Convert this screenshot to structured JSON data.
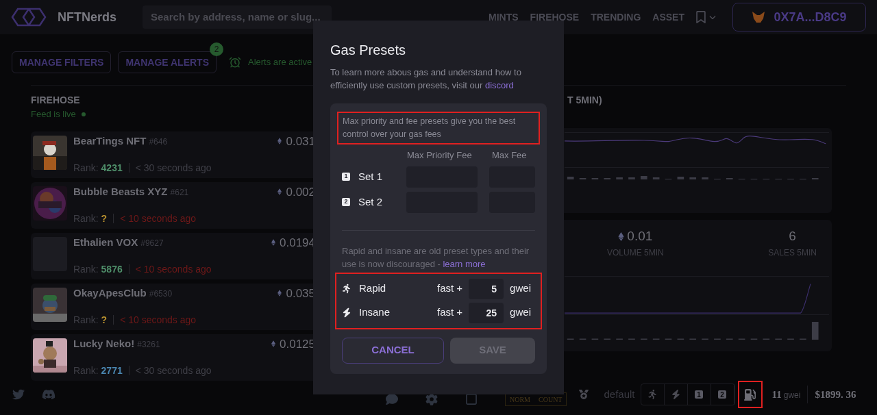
{
  "header": {
    "logo": "NFTNerds",
    "search": {
      "placeholder": "Search by address, name or slug..."
    },
    "nav": [
      "MINTS",
      "FIREHOSE",
      "TRENDING",
      "ASSET"
    ],
    "wallet": "0X7A...D8C9"
  },
  "toolbar": {
    "buttons": [
      "MANAGE FILTERS",
      "MANAGE ALERTS"
    ],
    "alerts_badge": "2",
    "alerts_status": "Alerts are active"
  },
  "feed": {
    "title": "FIREHOSE",
    "status": "Feed is live",
    "items": [
      {
        "name": "BearTings NFT",
        "token": "#646",
        "price": "0.031",
        "rank_label": "Rank:",
        "rank": "4231",
        "color": "#4f8f6a",
        "time": "< 30 seconds ago",
        "recent": false,
        "has_image": true
      },
      {
        "name": "Bubble Beasts XYZ",
        "token": "#621",
        "price": "0.002",
        "rank_label": "Rank:",
        "rank": "?",
        "color": "#b8912f",
        "time": "< 10 seconds ago",
        "recent": true,
        "has_image": true
      },
      {
        "name": "Ethalien VOX",
        "token": "#9627",
        "price": "0.0194",
        "rank_label": "Rank:",
        "rank": "5876",
        "color": "#4f8f6a",
        "time": "< 10 seconds ago",
        "recent": true,
        "has_image": false
      },
      {
        "name": "OkayApesClub",
        "token": "#6530",
        "price": "0.035",
        "rank_label": "Rank:",
        "rank": "?",
        "color": "#b8912f",
        "time": "< 10 seconds ago",
        "recent": true,
        "has_image": true
      },
      {
        "name": "Lucky Neko!",
        "token": "#3261",
        "price": "0.0125",
        "rank_label": "Rank:",
        "rank": "2771",
        "color": "#4a86b0",
        "time": "< 30 seconds ago",
        "recent": false,
        "has_image": true
      }
    ]
  },
  "stats_panel": {
    "heading": "T 5MIN)",
    "stats": [
      {
        "value": "0.01",
        "label": "VOLUME 5MIN",
        "eth": true
      },
      {
        "value": "6",
        "label": "SALES 5MIN",
        "eth": false
      }
    ]
  },
  "modal": {
    "title": "Gas Presets",
    "intro": "To learn more abous gas and understand how to efficiently use custom presets, visit our",
    "intro_link": "discord",
    "note": "Max priority and fee presets give you the best control over your gas fees",
    "columns": [
      "Max Priority Fee",
      "Max Fee"
    ],
    "sets": [
      {
        "badge": "1",
        "label": "Set 1"
      },
      {
        "badge": "2",
        "label": "Set 2"
      }
    ],
    "legacy_note": "Rapid and insane are old preset types and their use is now discouraged -",
    "legacy_link": "learn more",
    "presets": [
      {
        "kind": "rapid",
        "label": "Rapid",
        "prefix": "fast +",
        "value": "5",
        "unit": "gwei"
      },
      {
        "kind": "insane",
        "label": "Insane",
        "prefix": "fast +",
        "value": "25",
        "unit": "gwei"
      }
    ],
    "cancel": "CANCEL",
    "save": {
      "label": "SAVE",
      "disabled": true
    }
  },
  "footer": {
    "mode_tabs": [
      "NORM",
      "COUNT"
    ],
    "preset_label": "default",
    "preset_buttons": [
      {
        "kind": "rapid"
      },
      {
        "kind": "insane"
      },
      {
        "kind": "set",
        "badge": "1"
      },
      {
        "kind": "set",
        "badge": "2"
      }
    ],
    "gas": "11",
    "gas_unit": "gwei",
    "eth_price": "$1899. 36"
  }
}
